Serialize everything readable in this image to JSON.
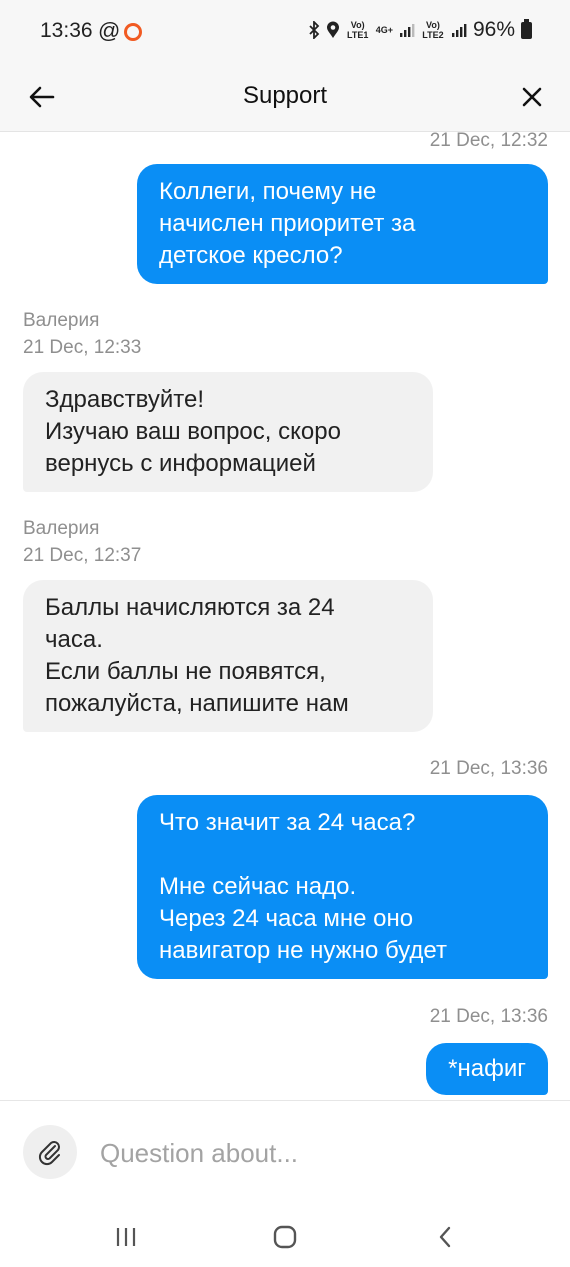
{
  "status_bar": {
    "time": "13:36",
    "at_symbol": "@",
    "network1": "Vo) LTE1",
    "network_type": "4G+",
    "network2": "Vo) LTE2",
    "battery": "96%",
    "notification_ring_color": "#f15a22"
  },
  "header": {
    "title": "Support",
    "back_icon": "arrow-left-icon",
    "close_icon": "close-icon"
  },
  "messages": [
    {
      "type": "outgoing",
      "timestamp": "21 Dec, 12:32",
      "text": "Коллеги, почему не\nначислен приоритет за\nдетское кресло?"
    },
    {
      "type": "incoming",
      "author": "Валерия",
      "timestamp": "21 Dec, 12:33",
      "text": "Здравствуйте!\nИзучаю ваш вопрос, скоро\nвернусь с информацией"
    },
    {
      "type": "incoming",
      "author": "Валерия",
      "timestamp": "21 Dec, 12:37",
      "text": "Баллы начисляются за 24\nчаса.\nЕсли баллы не появятся,\nпожалуйста, напишите нам"
    },
    {
      "type": "outgoing",
      "timestamp": "21 Dec, 13:36",
      "text": "Что значит за 24 часа?\n\nМне сейчас надо.\nЧерез 24 часа мне оно\nнавигатор не нужно будет"
    },
    {
      "type": "outgoing",
      "timestamp": "21 Dec, 13:36",
      "text": "*нафиг"
    }
  ],
  "input": {
    "placeholder": "Question about...",
    "attach_icon": "paperclip-icon"
  },
  "nav": {
    "recents_icon": "recents-icon",
    "home_icon": "home-icon",
    "back_icon": "back-chevron-icon"
  },
  "colors": {
    "outgoing_bubble": "#0a8ef5",
    "incoming_bubble": "#f1f1f1",
    "timestamp": "#8f8f8f"
  }
}
